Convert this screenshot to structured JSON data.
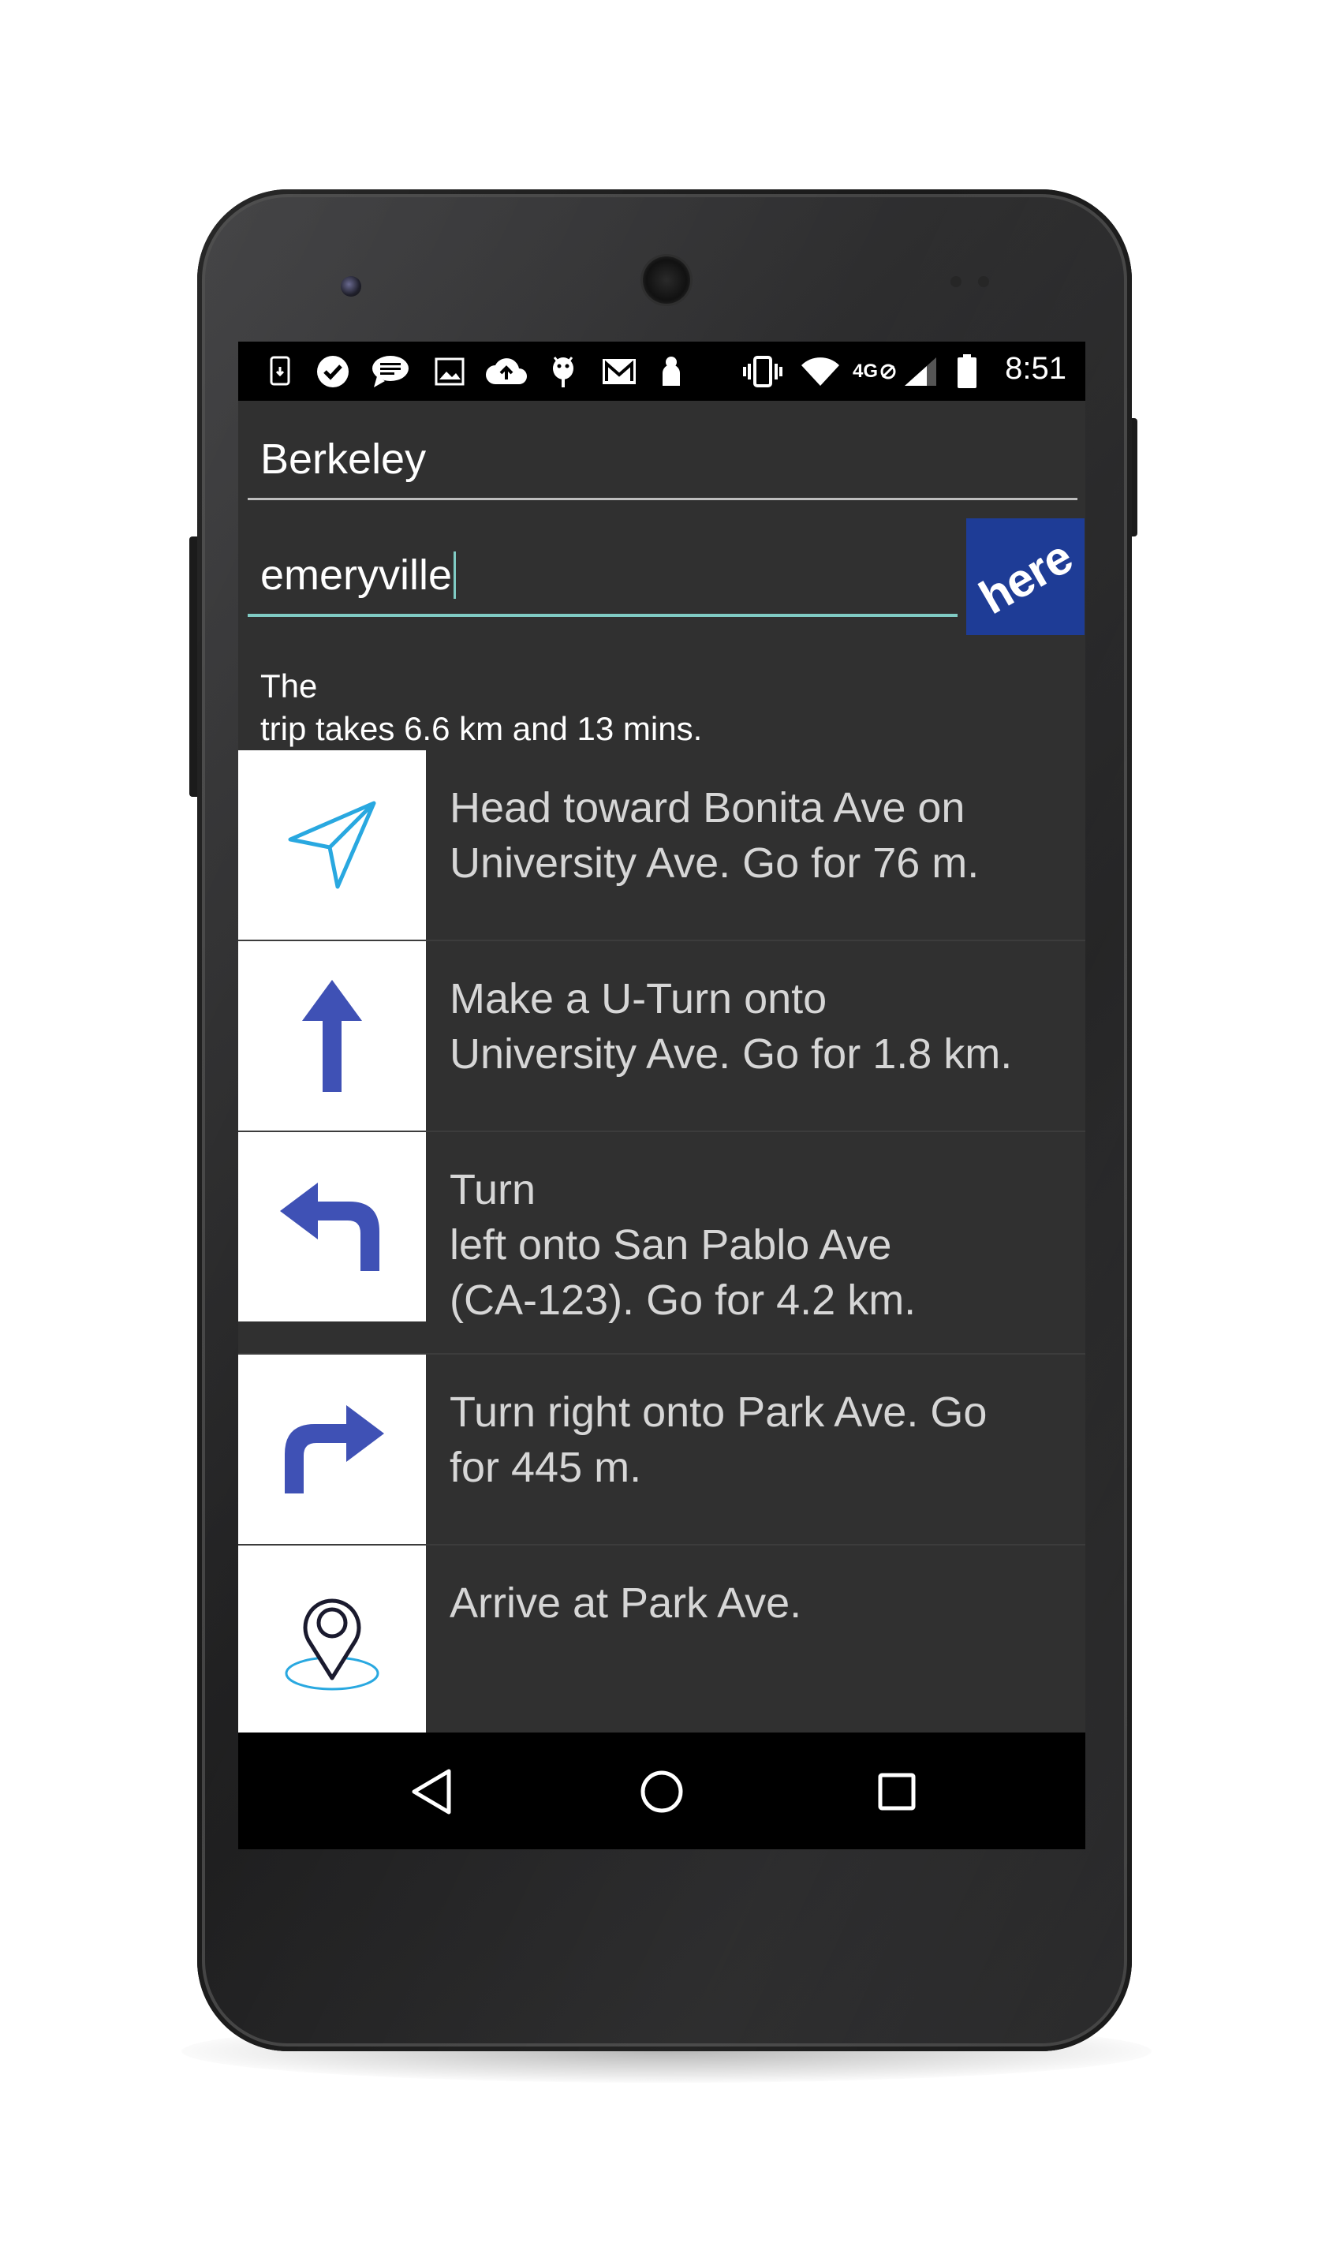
{
  "status_bar": {
    "time": "8:51",
    "network_label": "4G",
    "left_icons": [
      "phone-update-icon",
      "checkmark-badge-icon",
      "chat-bubble-icon",
      "image-icon",
      "cloud-upload-icon",
      "android-bug-icon",
      "mail-icon",
      "person-icon"
    ],
    "right_icons": [
      "vibrate-icon",
      "wifi-icon",
      "network-4g-icon",
      "signal-icon",
      "battery-icon"
    ]
  },
  "route_form": {
    "from_value": "Berkeley",
    "to_value": "emeryville",
    "submit_logo": "here"
  },
  "summary": {
    "text": "The\ntrip takes 6.6 km and 13 mins."
  },
  "maneuvers": [
    {
      "icon": "navigation-arrow-icon",
      "text": "Head toward Bonita Ave on\nUniversity Ave. Go for 76 m."
    },
    {
      "icon": "straight-arrow-icon",
      "text": "Make a U-Turn onto\nUniversity Ave. Go for 1.8 km."
    },
    {
      "icon": "turn-left-icon",
      "text": "Turn\nleft onto San Pablo Ave\n(CA-123). Go for 4.2 km."
    },
    {
      "icon": "turn-right-icon",
      "text": "Turn right onto Park Ave. Go\nfor 445 m."
    },
    {
      "icon": "destination-pin-icon",
      "text": "Arrive at Park Ave."
    }
  ],
  "nav_bar": {
    "buttons": [
      "back-icon",
      "home-icon",
      "recents-icon"
    ]
  },
  "colors": {
    "screen_background": "#303030",
    "accent_teal": "#80cbc4",
    "maneuver_blue": "#3f51b5",
    "nav_arrow_cyan": "#29a8e0",
    "here_blue": "#1e3c96"
  }
}
